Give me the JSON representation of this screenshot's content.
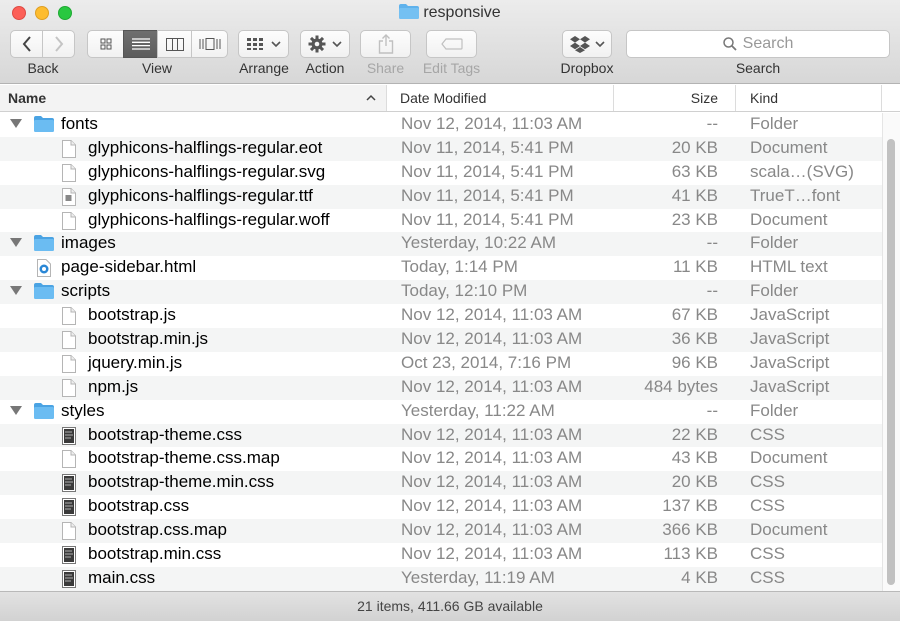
{
  "window": {
    "title": "responsive"
  },
  "toolbar": {
    "back_label": "Back",
    "view_label": "View",
    "arrange_label": "Arrange",
    "action_label": "Action",
    "share_label": "Share",
    "edit_tags_label": "Edit Tags",
    "dropbox_label": "Dropbox",
    "search_label": "Search",
    "search_placeholder": "Search",
    "active_view": "list"
  },
  "columns": {
    "name": "Name",
    "date": "Date Modified",
    "size": "Size",
    "kind": "Kind",
    "sort_indicator": "^"
  },
  "rows": [
    {
      "name": "fonts",
      "date": "Nov 12, 2014, 11:03 AM",
      "size": "--",
      "kind": "Folder",
      "type": "folder",
      "level": 0
    },
    {
      "name": "glyphicons-halflings-regular.eot",
      "date": "Nov 11, 2014, 5:41 PM",
      "size": "20 KB",
      "kind": "Document",
      "type": "doc",
      "level": 1
    },
    {
      "name": "glyphicons-halflings-regular.svg",
      "date": "Nov 11, 2014, 5:41 PM",
      "size": "63 KB",
      "kind": "scala…(SVG)",
      "type": "doc",
      "level": 1
    },
    {
      "name": "glyphicons-halflings-regular.ttf",
      "date": "Nov 11, 2014, 5:41 PM",
      "size": "41 KB",
      "kind": "TrueT…font",
      "type": "font",
      "level": 1
    },
    {
      "name": "glyphicons-halflings-regular.woff",
      "date": "Nov 11, 2014, 5:41 PM",
      "size": "23 KB",
      "kind": "Document",
      "type": "doc",
      "level": 1
    },
    {
      "name": "images",
      "date": "Yesterday, 10:22 AM",
      "size": "--",
      "kind": "Folder",
      "type": "folder",
      "level": 0
    },
    {
      "name": "page-sidebar.html",
      "date": "Today, 1:14 PM",
      "size": "11 KB",
      "kind": "HTML text",
      "type": "html",
      "level": 0
    },
    {
      "name": "scripts",
      "date": "Today, 12:10 PM",
      "size": "--",
      "kind": "Folder",
      "type": "folder",
      "level": 0
    },
    {
      "name": "bootstrap.js",
      "date": "Nov 12, 2014, 11:03 AM",
      "size": "67 KB",
      "kind": "JavaScript",
      "type": "doc",
      "level": 1
    },
    {
      "name": "bootstrap.min.js",
      "date": "Nov 12, 2014, 11:03 AM",
      "size": "36 KB",
      "kind": "JavaScript",
      "type": "doc",
      "level": 1
    },
    {
      "name": "jquery.min.js",
      "date": "Oct 23, 2014, 7:16 PM",
      "size": "96 KB",
      "kind": "JavaScript",
      "type": "doc",
      "level": 1
    },
    {
      "name": "npm.js",
      "date": "Nov 12, 2014, 11:03 AM",
      "size": "484 bytes",
      "kind": "JavaScript",
      "type": "doc",
      "level": 1
    },
    {
      "name": "styles",
      "date": "Yesterday, 11:22 AM",
      "size": "--",
      "kind": "Folder",
      "type": "folder",
      "level": 0
    },
    {
      "name": "bootstrap-theme.css",
      "date": "Nov 12, 2014, 11:03 AM",
      "size": "22 KB",
      "kind": "CSS",
      "type": "css",
      "level": 1
    },
    {
      "name": "bootstrap-theme.css.map",
      "date": "Nov 12, 2014, 11:03 AM",
      "size": "43 KB",
      "kind": "Document",
      "type": "doc",
      "level": 1
    },
    {
      "name": "bootstrap-theme.min.css",
      "date": "Nov 12, 2014, 11:03 AM",
      "size": "20 KB",
      "kind": "CSS",
      "type": "css",
      "level": 1
    },
    {
      "name": "bootstrap.css",
      "date": "Nov 12, 2014, 11:03 AM",
      "size": "137 KB",
      "kind": "CSS",
      "type": "css",
      "level": 1
    },
    {
      "name": "bootstrap.css.map",
      "date": "Nov 12, 2014, 11:03 AM",
      "size": "366 KB",
      "kind": "Document",
      "type": "doc",
      "level": 1
    },
    {
      "name": "bootstrap.min.css",
      "date": "Nov 12, 2014, 11:03 AM",
      "size": "113 KB",
      "kind": "CSS",
      "type": "css",
      "level": 1
    },
    {
      "name": "main.css",
      "date": "Yesterday, 11:19 AM",
      "size": "4 KB",
      "kind": "CSS",
      "type": "css",
      "level": 1
    }
  ],
  "status": {
    "text": "21 items, 411.66 GB available"
  },
  "colors": {
    "folder_blue": "#5fb2ec",
    "active_view_bg": "#666666"
  }
}
